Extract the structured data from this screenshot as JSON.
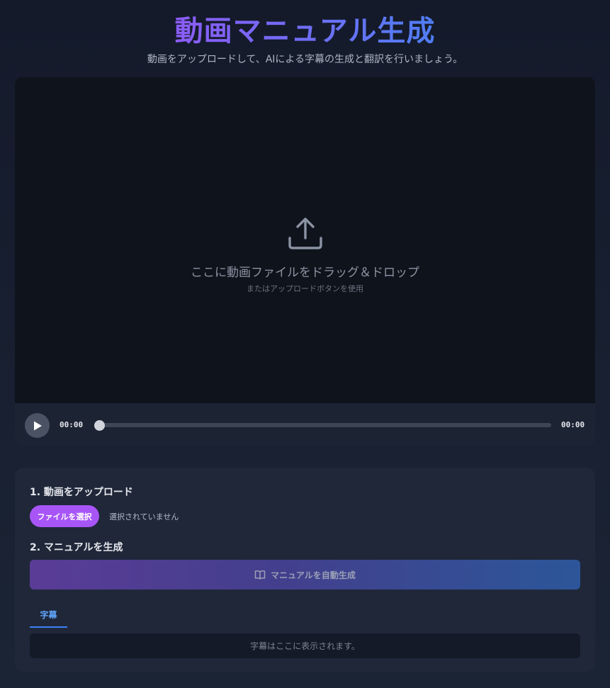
{
  "header": {
    "title": "動画マニュアル生成",
    "subtitle": "動画をアップロードして、AIによる字幕の生成と翻訳を行いましょう。"
  },
  "player": {
    "dropzone": {
      "icon": "upload-icon",
      "text": "ここに動画ファイルをドラッグ＆ドロップ",
      "subtext": "またはアップロードボタンを使用"
    },
    "controls": {
      "play_icon": "play-icon",
      "current_time": "00:00",
      "duration": "00:00",
      "progress": 0
    }
  },
  "steps": {
    "upload": {
      "title": "1. 動画をアップロード",
      "button_label": "ファイルを選択",
      "status": "選択されていません"
    },
    "generate": {
      "title": "2. マニュアルを生成",
      "button_icon": "book-open-icon",
      "button_label": "マニュアルを自動生成"
    }
  },
  "tabs": [
    {
      "label": "字幕",
      "active": true
    }
  ],
  "subtitles": {
    "placeholder": "字幕はここに表示されます。"
  },
  "colors": {
    "accent_purple": "#a855f7",
    "accent_blue": "#3b82f6",
    "background": "#161d2d"
  }
}
